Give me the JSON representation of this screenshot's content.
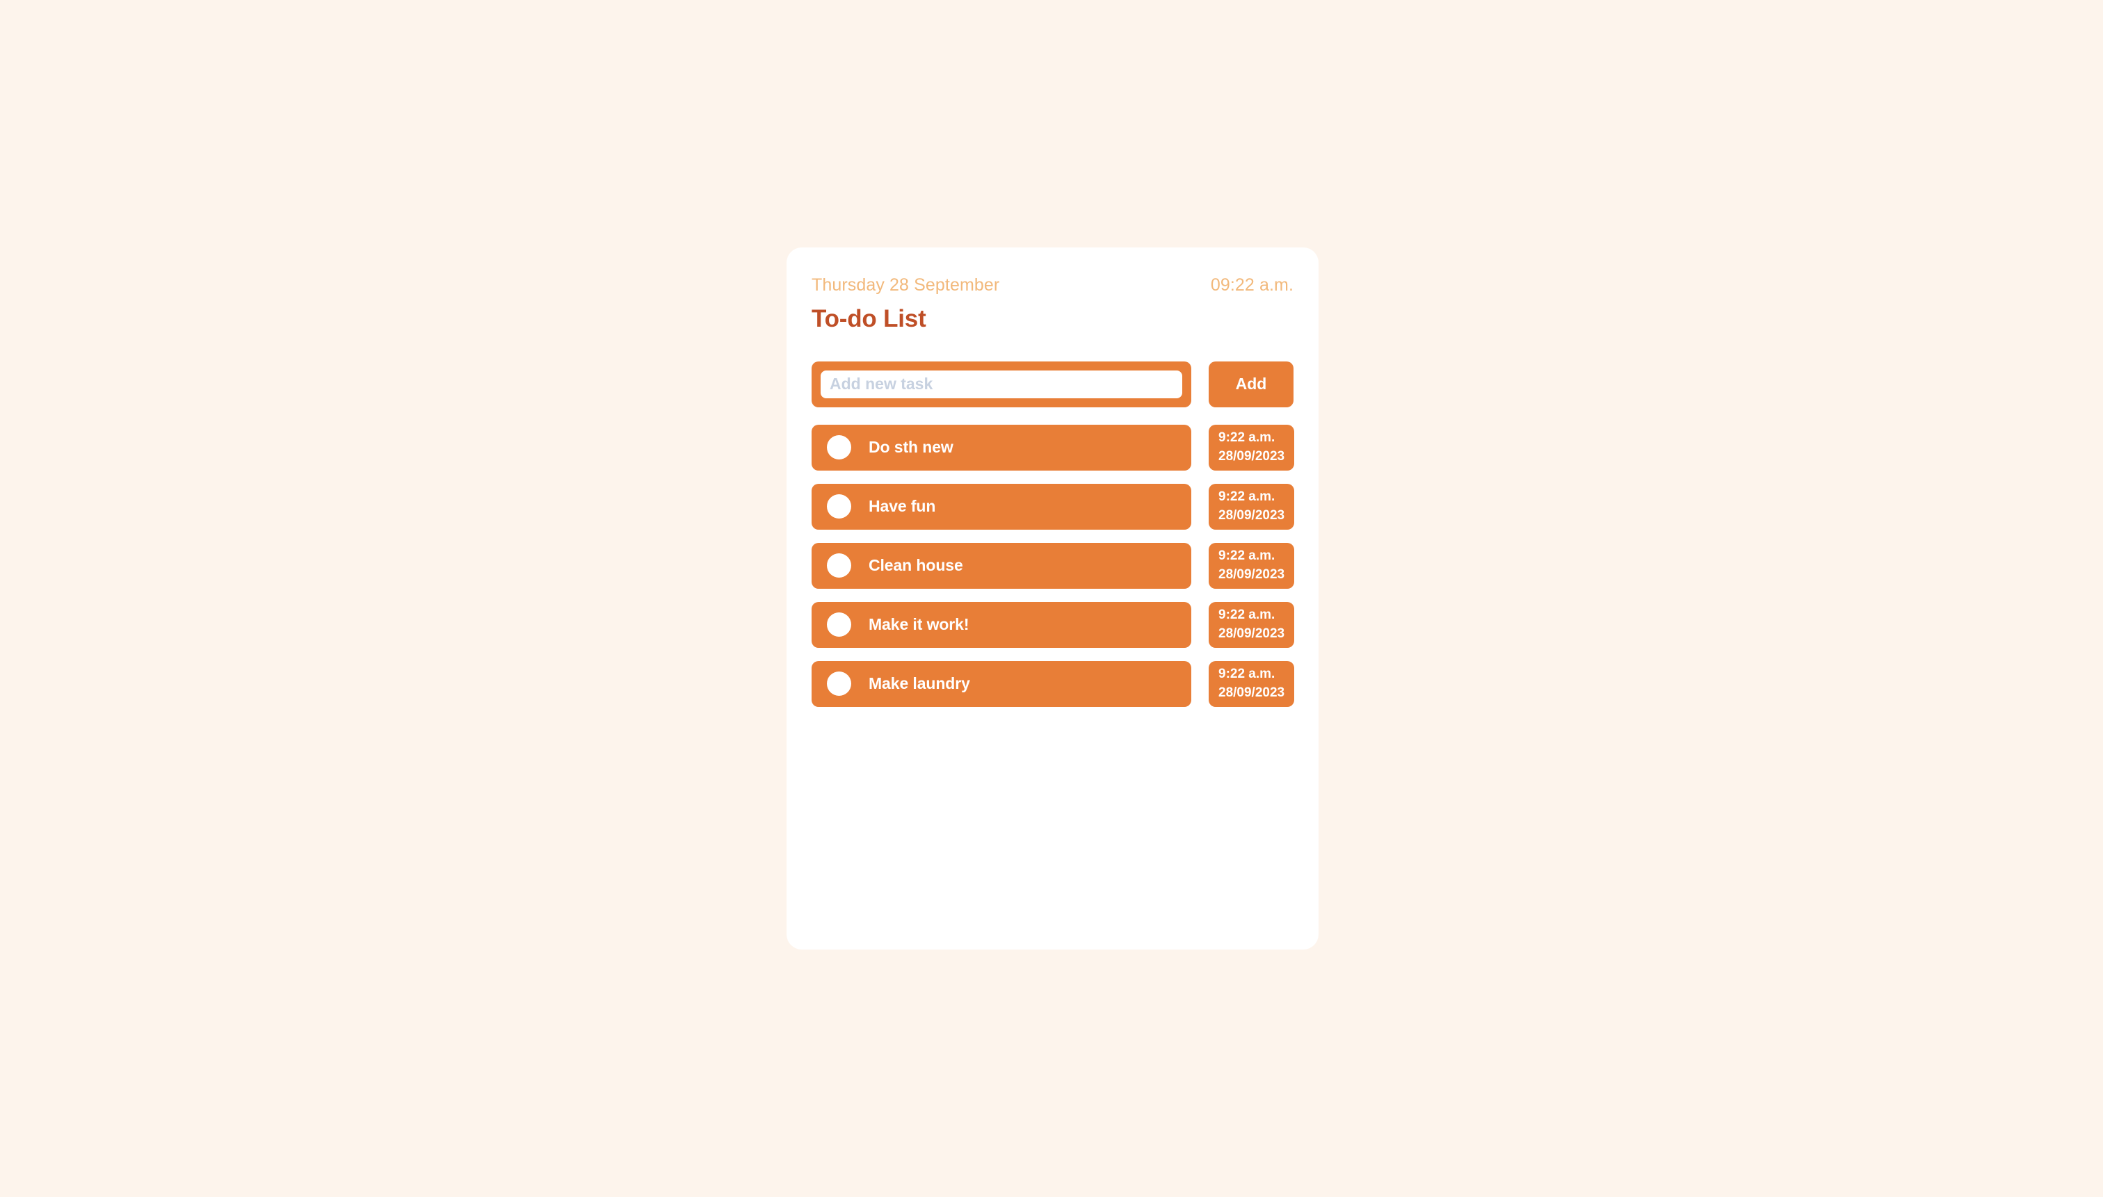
{
  "app": {
    "title": "To-do List",
    "background_color": "#fdf4ec",
    "card_color": "#ffffff",
    "accent_color": "#e87e37",
    "title_color": "#bf4f27",
    "muted_color": "#f2b97c"
  },
  "header": {
    "date": "Thursday 28 September",
    "time": "09:22 a.m."
  },
  "compose": {
    "placeholder": "Add new task",
    "value": "",
    "add_label": "Add"
  },
  "tasks": [
    {
      "label": "Do sth new",
      "time": "9:22 a.m.",
      "date": "28/09/2023",
      "done": false
    },
    {
      "label": "Have fun",
      "time": "9:22 a.m.",
      "date": "28/09/2023",
      "done": false
    },
    {
      "label": "Clean house",
      "time": "9:22 a.m.",
      "date": "28/09/2023",
      "done": false
    },
    {
      "label": "Make it work!",
      "time": "9:22 a.m.",
      "date": "28/09/2023",
      "done": false
    },
    {
      "label": "Make laundry",
      "time": "9:22 a.m.",
      "date": "28/09/2023",
      "done": false
    }
  ]
}
